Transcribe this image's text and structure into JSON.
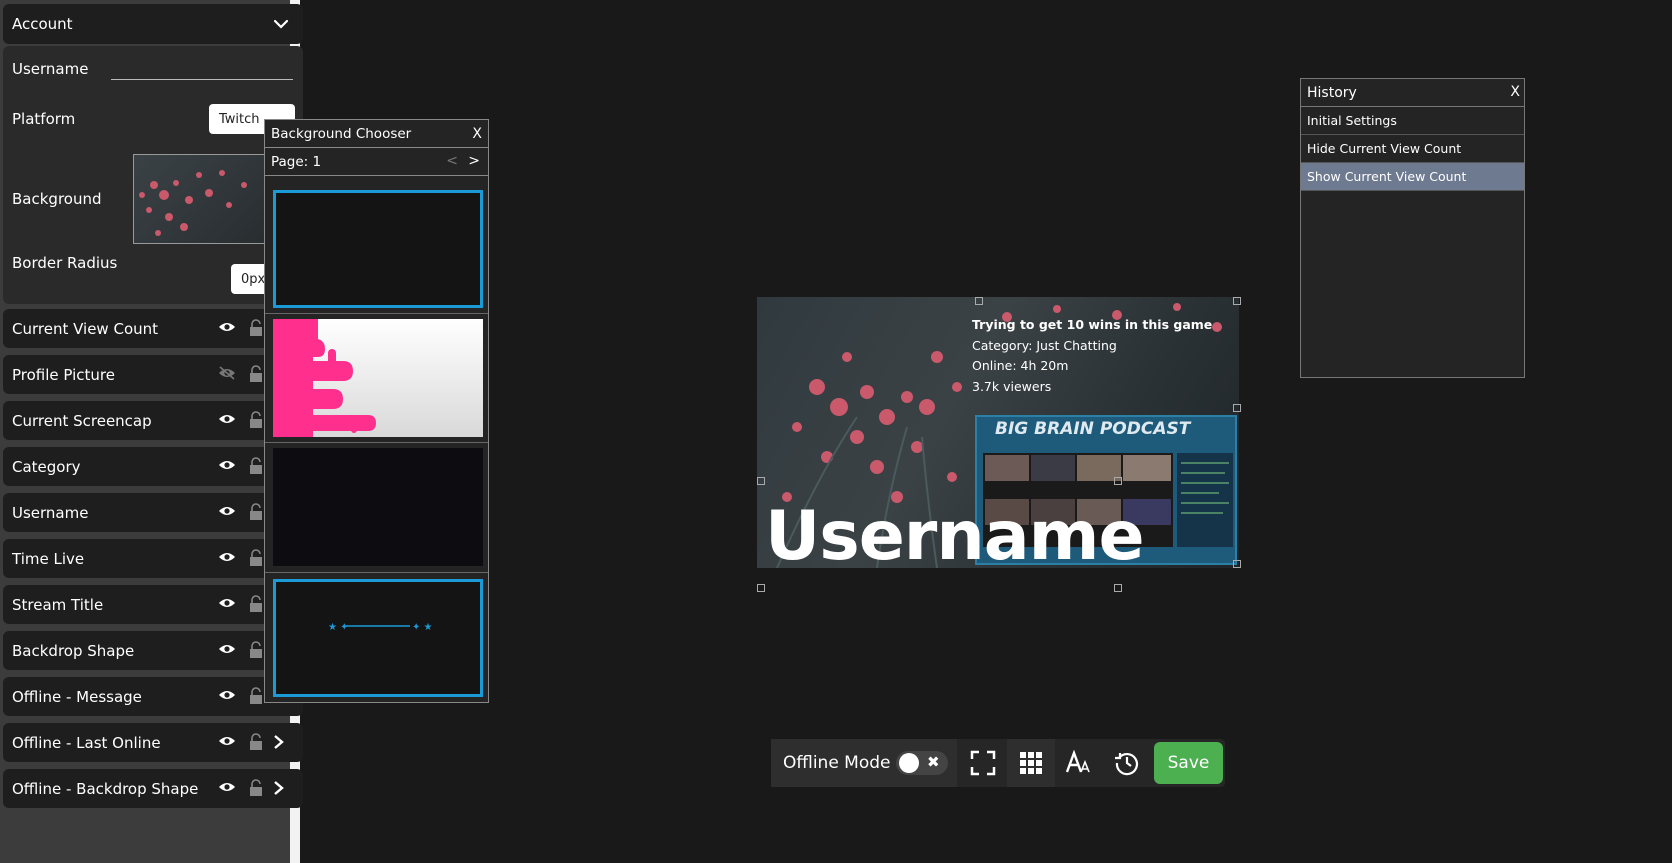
{
  "sidebar": {
    "account": {
      "title": "Account"
    },
    "fields": {
      "username_label": "Username",
      "username_value": "",
      "platform_label": "Platform",
      "platform_value": "Twitch",
      "background_label": "Background",
      "border_radius_label": "Border Radius",
      "border_radius_value": "0px"
    },
    "layers": [
      {
        "label": "Current View Count",
        "visible": true
      },
      {
        "label": "Profile Picture",
        "visible": false
      },
      {
        "label": "Current Screencap",
        "visible": true
      },
      {
        "label": "Category",
        "visible": true
      },
      {
        "label": "Username",
        "visible": true
      },
      {
        "label": "Time Live",
        "visible": true
      },
      {
        "label": "Stream Title",
        "visible": true
      },
      {
        "label": "Backdrop Shape",
        "visible": true
      },
      {
        "label": "Offline - Message",
        "visible": true
      },
      {
        "label": "Offline - Last Online",
        "visible": true
      },
      {
        "label": "Offline - Backdrop Shape",
        "visible": true
      }
    ]
  },
  "background_chooser": {
    "title": "Background Chooser",
    "close": "X",
    "page_label": "Page: 1",
    "prev": "<",
    "next": ">"
  },
  "history": {
    "title": "History",
    "close": "X",
    "items": [
      "Initial Settings",
      "Hide Current View Count",
      "Show Current View Count"
    ],
    "active_index": 2
  },
  "preview": {
    "stream_title": "Trying to get 10 wins in this game",
    "category": "Category: Just Chatting",
    "online": "Online: 4h 20m",
    "viewers": "3.7k viewers",
    "screencap_title": "BIG BRAIN PODCAST",
    "username": "Username"
  },
  "toolbar": {
    "offline_mode_label": "Offline Mode",
    "save_label": "Save"
  },
  "colors": {
    "save": "#4caf50",
    "accent_blue": "#1a9ad6",
    "active_history": "#6e7a90",
    "flower_pink": "#c9596b"
  }
}
